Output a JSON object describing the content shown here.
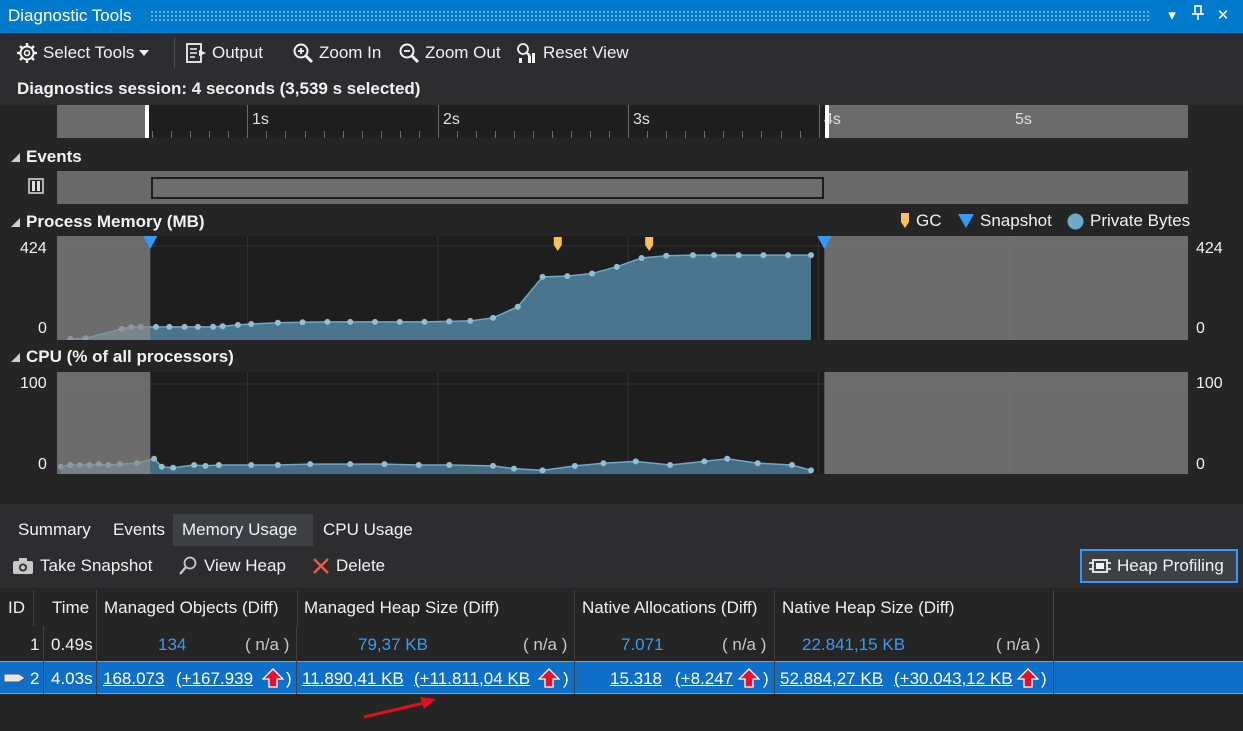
{
  "window": {
    "title": "Diagnostic Tools",
    "dropdown_glyph": "▾",
    "pin_glyph": "⊥",
    "close_glyph": "✕"
  },
  "toolbar": {
    "select_tools": "Select Tools",
    "output": "Output",
    "zoom_in": "Zoom In",
    "zoom_out": "Zoom Out",
    "reset_view": "Reset View"
  },
  "session": {
    "text": "Diagnostics session: 4 seconds (3,539 s selected)"
  },
  "ruler": {
    "labels": [
      "1s",
      "2s",
      "3s",
      "4s",
      "5s"
    ],
    "selection_start_s": 0.49,
    "selection_end_s": 4.03,
    "max_s": 5.94
  },
  "events": {
    "title": "Events"
  },
  "memory": {
    "title": "Process Memory (MB)",
    "y_max_label": "424",
    "y_min_label": "0",
    "legend": {
      "gc": "GC",
      "snapshot": "Snapshot",
      "private_bytes": "Private Bytes"
    },
    "colors": {
      "gc": "#f5c15b",
      "snapshot": "#3399ff",
      "private_bytes": "#6fa8c8",
      "fill": "#4e7a93"
    }
  },
  "cpu": {
    "title": "CPU (% of all processors)",
    "y_max_label": "100",
    "y_min_label": "0"
  },
  "chart_data": [
    {
      "type": "area",
      "title": "Process Memory (MB)",
      "xlabel": "",
      "ylabel": "",
      "ylim": [
        0,
        424
      ],
      "xlim": [
        0,
        5.94
      ],
      "series": [
        {
          "name": "Private Bytes",
          "x": [
            0.07,
            0.15,
            0.34,
            0.39,
            0.44,
            0.52,
            0.59,
            0.67,
            0.74,
            0.82,
            0.87,
            0.95,
            1.02,
            1.16,
            1.29,
            1.42,
            1.54,
            1.67,
            1.8,
            1.93,
            2.06,
            2.17,
            2.29,
            2.42,
            2.55,
            2.68,
            2.81,
            2.94,
            3.07,
            3.2,
            3.34,
            3.45,
            3.58,
            3.71,
            3.84,
            3.96
          ],
          "values": [
            5,
            8,
            50,
            58,
            59,
            59,
            59,
            59,
            59,
            60,
            62,
            68,
            72,
            78,
            80,
            82,
            82,
            82,
            82,
            82,
            84,
            86,
            100,
            150,
            285,
            288,
            300,
            330,
            370,
            380,
            383,
            383,
            383,
            383,
            383,
            383
          ]
        }
      ],
      "gc_markers_s": [
        2.63,
        3.11
      ],
      "snapshots_s": [
        0.49,
        4.03
      ]
    },
    {
      "type": "area",
      "title": "CPU (% of all processors)",
      "xlabel": "",
      "ylabel": "",
      "ylim": [
        0,
        100
      ],
      "xlim": [
        0,
        5.94
      ],
      "series": [
        {
          "name": "",
          "x": [
            0.02,
            0.07,
            0.12,
            0.17,
            0.22,
            0.27,
            0.33,
            0.42,
            0.51,
            0.55,
            0.61,
            0.72,
            0.78,
            0.85,
            1.02,
            1.16,
            1.33,
            1.54,
            1.72,
            1.9,
            2.06,
            2.29,
            2.4,
            2.55,
            2.72,
            2.87,
            3.04,
            3.22,
            3.4,
            3.52,
            3.68,
            3.86,
            3.96
          ],
          "values": [
            8,
            10,
            10,
            10,
            11,
            10,
            11,
            12,
            17,
            8,
            7,
            10,
            9,
            10,
            10,
            10,
            11,
            11,
            11,
            10,
            10,
            9,
            6,
            4,
            9,
            12,
            14,
            10,
            14,
            17,
            12,
            10,
            4
          ]
        }
      ]
    }
  ],
  "tabs": [
    "Summary",
    "Events",
    "Memory Usage",
    "CPU Usage"
  ],
  "actions": {
    "take_snapshot": "Take Snapshot",
    "view_heap": "View Heap",
    "delete": "Delete",
    "heap_profiling": "Heap Profiling"
  },
  "table": {
    "columns": [
      "ID",
      "Time",
      "Managed Objects (Diff)",
      "Managed Heap Size (Diff)",
      "Native Allocations (Diff)",
      "Native Heap Size (Diff)"
    ],
    "rows": [
      {
        "id": "1",
        "time": "0.49s",
        "managed_objects": "134",
        "managed_objects_diff": "( n/a )",
        "managed_heap": "79,37 KB",
        "managed_heap_diff": "( n/a )",
        "native_allocs": "7.071",
        "native_allocs_diff": "( n/a )",
        "native_heap": "22.841,15 KB",
        "native_heap_diff": "( n/a )"
      },
      {
        "id": "2",
        "time": "4.03s",
        "managed_objects": "168.073",
        "managed_objects_diff": "(+167.939",
        "managed_heap": "11.890,41 KB",
        "managed_heap_diff": "(+11.811,04 KB",
        "native_allocs": "15.318",
        "native_allocs_diff": "(+8.247",
        "native_heap": "52.884,27 KB",
        "native_heap_diff": "(+30.043,12 KB",
        "close_paren": ")"
      }
    ]
  }
}
